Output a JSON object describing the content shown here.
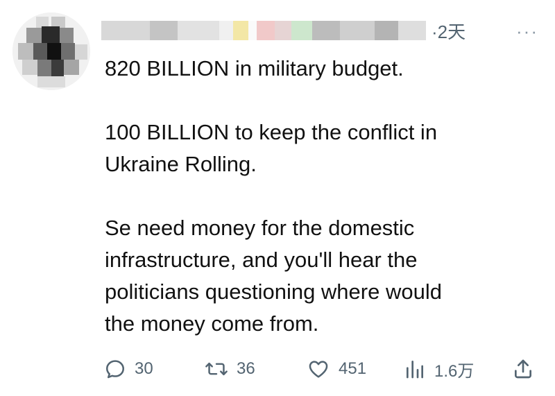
{
  "header": {
    "time": "·2天",
    "more_label": "···"
  },
  "tweet": {
    "paragraph1": "820 BILLION in military budget.",
    "paragraph2_line1": "100 BILLION to keep the conflict in",
    "paragraph2_line2": "Ukraine Rolling.",
    "paragraph3_line1": "Se need money for the domestic",
    "paragraph3_line2": "infrastructure, and you'll hear the",
    "paragraph3_line3": "politicians questioning where would",
    "paragraph3_line4": "the money come from."
  },
  "actions": {
    "reply_count": "30",
    "retweet_count": "36",
    "like_count": "451",
    "views_count": "1.6万"
  },
  "icons": {
    "reply": "reply-icon",
    "retweet": "retweet-icon",
    "like": "heart-icon",
    "views": "views-icon",
    "share": "share-icon"
  },
  "colors": {
    "text": "#0f1419",
    "muted": "#536471"
  }
}
